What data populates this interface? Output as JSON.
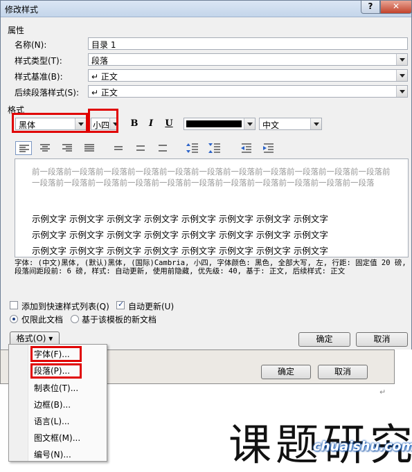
{
  "window": {
    "title": "修改样式",
    "help_label": "?",
    "close_label": "✕"
  },
  "properties": {
    "section_label": "属性",
    "name": {
      "label": "名称(N):",
      "value": "目录 1"
    },
    "style_type": {
      "label": "样式类型(T):",
      "value": "段落"
    },
    "style_based_on": {
      "label": "样式基准(B):",
      "value": "↵ 正文"
    },
    "following_style": {
      "label": "后续段落样式(S):",
      "value": "↵ 正文"
    }
  },
  "format": {
    "section_label": "格式",
    "font": "黑体",
    "size": "小四",
    "bold": "B",
    "italic": "I",
    "underline": "U",
    "color": "#000000",
    "script": "中文"
  },
  "preview": {
    "previous_text": "前一段落前一段落前一段落前一段落前一段落前一段落前一段落前一段落前一段落前一段落前一段落前一段落前一段落前一段落前一段落前一段落前一段落前一段落前一段落前一段落前一段落前一段落",
    "sample_rows": [
      "示例文字  示例文字  示例文字  示例文字  示例文字  示例文字  示例文字  示例文字",
      "示例文字  示例文字  示例文字  示例文字  示例文字  示例文字  示例文字  示例文字",
      "示例文字  示例文字  示例文字  示例文字  示例文字  示例文字  示例文字  示例文字"
    ]
  },
  "description": "字体: (中文)黑体, (默认)黑体, (国际)Cambria, 小四, 字体颜色: 黑色, 全部大写, 左, 行距: 固定值 20 磅, 段落间距段前: 6 磅, 样式: 自动更新, 使用前隐藏, 优先级: 40, 基于: 正文, 后续样式: 正文",
  "options": {
    "add_to_quick_styles": "添加到快速样式列表(Q)",
    "auto_update": "自动更新(U)",
    "only_this_doc": "仅限此文档",
    "new_docs_template": "基于该模板的新文档"
  },
  "buttons": {
    "format_menu": "格式(O) ▾",
    "ok": "确定",
    "cancel": "取消"
  },
  "format_menu_items": [
    "字体(F)...",
    "段落(P)...",
    "制表位(T)...",
    "边框(B)...",
    "语言(L)...",
    "图文框(M)...",
    "编号(N)..."
  ],
  "background": {
    "heading": "课题研究",
    "ok": "确定",
    "cancel": "取消",
    "paragraph_mark": "↵"
  },
  "watermark": "chuaishu.com"
}
